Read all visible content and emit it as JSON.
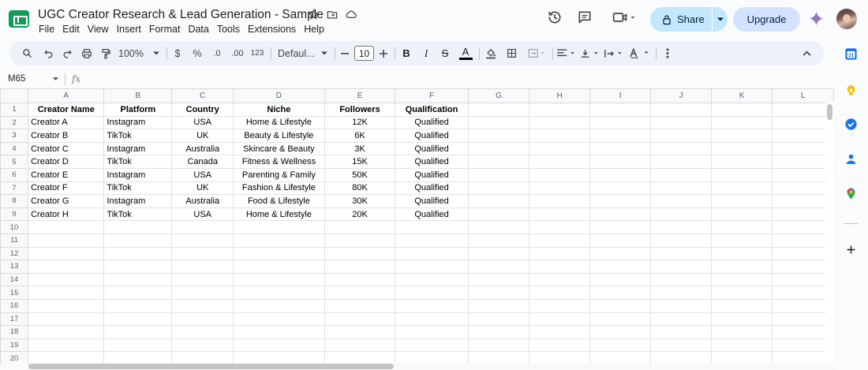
{
  "header": {
    "title": "UGC Creator Research & Lead Generation - Sample",
    "menu": [
      "File",
      "Edit",
      "View",
      "Insert",
      "Format",
      "Data",
      "Tools",
      "Extensions",
      "Help"
    ],
    "share_label": "Share",
    "upgrade_label": "Upgrade"
  },
  "toolbar": {
    "zoom": "100%",
    "currency": "$",
    "percent": "%",
    "decrease_decimal": ".0",
    "increase_decimal": ".00",
    "number_format": "123",
    "font": "Defaul...",
    "font_size": "10",
    "bold": "B",
    "italic": "I",
    "strike": "S",
    "text_color": "A"
  },
  "formula_bar": {
    "name_box": "M65",
    "fx": "fx"
  },
  "sheet": {
    "columns": [
      "A",
      "B",
      "C",
      "D",
      "E",
      "F",
      "G",
      "H",
      "I",
      "J",
      "K",
      "L"
    ],
    "row_numbers": [
      "1",
      "2",
      "3",
      "4",
      "5",
      "6",
      "7",
      "8",
      "9",
      "10",
      "11",
      "12",
      "13",
      "14",
      "15",
      "16",
      "17",
      "18",
      "19",
      "20"
    ],
    "headers": [
      "Creator Name",
      "Platform",
      "Country",
      "Niche",
      "Followers",
      "Qualification"
    ],
    "rows": [
      [
        "Creator A",
        "Instagram",
        "USA",
        "Home & Lifestyle",
        "12K",
        "Qualified"
      ],
      [
        "Creator B",
        "TikTok",
        "UK",
        "Beauty & Lifestyle",
        "6K",
        "Qualified"
      ],
      [
        "Creator C",
        "Instagram",
        "Australia",
        "Skincare & Beauty",
        "3K",
        "Qualified"
      ],
      [
        "Creator D",
        "TikTok",
        "Canada",
        "Fitness & Wellness",
        "15K",
        "Qualified"
      ],
      [
        "Creator E",
        "Instagram",
        "USA",
        "Parenting & Family",
        "50K",
        "Qualified"
      ],
      [
        "Creator F",
        "TikTok",
        "UK",
        "Fashion & Lifestyle",
        "80K",
        "Qualified"
      ],
      [
        "Creator G",
        "Instagram",
        "Australia",
        "Food & Lifestyle",
        "30K",
        "Qualified"
      ],
      [
        "Creator H",
        "TikTok",
        "USA",
        "Home & Lifestyle",
        "20K",
        "Qualified"
      ]
    ]
  },
  "colors": {
    "brand": "#0f9d58",
    "share_bg": "#c2e7ff",
    "upgrade_bg": "#d3e3fd",
    "toolbar_bg": "#edf2fa"
  }
}
